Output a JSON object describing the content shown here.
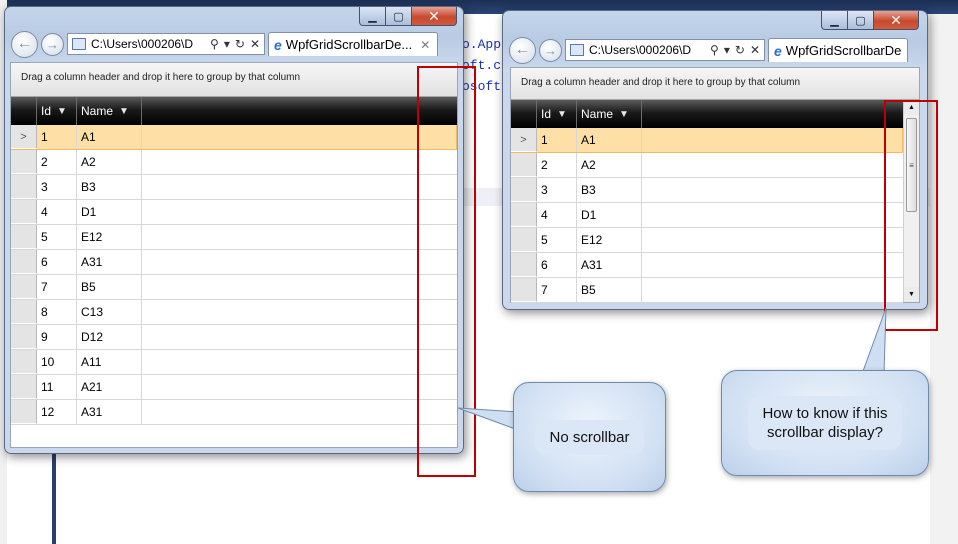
{
  "background": {
    "code_lines": [
      "o.App",
      "oft.c",
      "osoft"
    ]
  },
  "window_left": {
    "address": "C:\\Users\\000206\\D",
    "tab_title": "WpfGridScrollbarDe...",
    "group_panel_text": "Drag a column header and drop it here to group by that column",
    "columns": [
      "Id",
      "Name"
    ],
    "rows": [
      {
        "id": "1",
        "name": "A1"
      },
      {
        "id": "2",
        "name": "A2"
      },
      {
        "id": "3",
        "name": "B3"
      },
      {
        "id": "4",
        "name": "D1"
      },
      {
        "id": "5",
        "name": "E12"
      },
      {
        "id": "6",
        "name": "A31"
      },
      {
        "id": "7",
        "name": "B5"
      },
      {
        "id": "8",
        "name": "C13"
      },
      {
        "id": "9",
        "name": "D12"
      },
      {
        "id": "10",
        "name": "A11"
      },
      {
        "id": "11",
        "name": "A21"
      },
      {
        "id": "12",
        "name": "A31"
      }
    ],
    "current_row_indicator": ">"
  },
  "window_right": {
    "address": "C:\\Users\\000206\\D",
    "tab_title": "WpfGridScrollbarDe",
    "group_panel_text": "Drag a column header and drop it here to group by that column",
    "columns": [
      "Id",
      "Name"
    ],
    "rows": [
      {
        "id": "1",
        "name": "A1"
      },
      {
        "id": "2",
        "name": "A2"
      },
      {
        "id": "3",
        "name": "B3"
      },
      {
        "id": "4",
        "name": "D1"
      },
      {
        "id": "5",
        "name": "E12"
      },
      {
        "id": "6",
        "name": "A31"
      },
      {
        "id": "7",
        "name": "B5"
      }
    ],
    "current_row_indicator": ">"
  },
  "callouts": {
    "no_scrollbar": "No scrollbar",
    "question_line1": "How to know if this",
    "question_line2": "scrollbar display?"
  },
  "icons": {
    "back": "back-arrow-icon",
    "forward": "forward-arrow-icon",
    "filter": "filter-funnel-icon",
    "search": "search-icon",
    "refresh": "refresh-icon",
    "close": "close-icon",
    "ie": "internet-explorer-icon"
  },
  "colors": {
    "selected_row": "#fedfa6",
    "header_bg": "#000000",
    "highlight_box": "#c00000",
    "close_button": "#c74a2f"
  }
}
